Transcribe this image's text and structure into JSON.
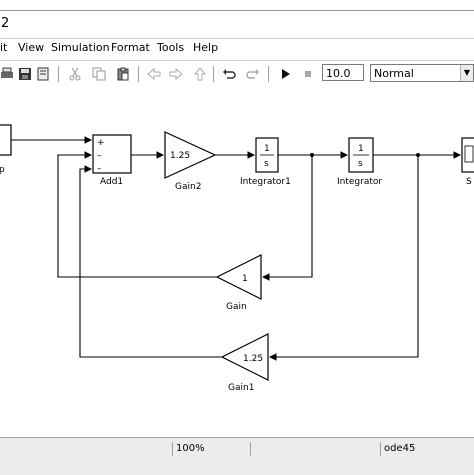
{
  "window": {
    "title_fragment": "2"
  },
  "menu": [
    "it",
    "View",
    "Simulation",
    "Format",
    "Tools",
    "Help"
  ],
  "toolbar": {
    "stop_time": "10.0",
    "sim_mode": "Normal"
  },
  "blocks": {
    "step_label": "p",
    "add1_label": "Add1",
    "add_signs": [
      "+",
      "–",
      "–"
    ],
    "gain2_value": "1.25",
    "gain2_label": "Gain2",
    "integrator1_num": "1",
    "integrator1_den": "s",
    "integrator1_label": "Integrator1",
    "integrator_num": "1",
    "integrator_den": "s",
    "integrator_label": "Integrator",
    "scope_label": "S",
    "gain_value": "1",
    "gain_label": "Gain",
    "gain1_value": "1.25",
    "gain1_label": "Gain1"
  },
  "status": {
    "zoom": "100%",
    "solver": "ode45"
  }
}
